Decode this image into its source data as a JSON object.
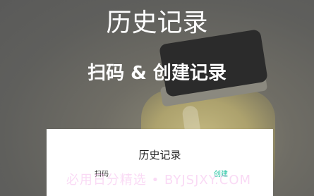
{
  "hero": {
    "title": "历史记录",
    "subtitle": "扫码 & 创建记录"
  },
  "panel": {
    "title": "历史记录",
    "scan_label": "扫码",
    "create_label": "创建"
  },
  "watermark": {
    "text": "必用日分精选 • BYJSJXY.COM"
  },
  "colors": {
    "accent": "#1fc3a0",
    "panel_background": "#ffffff",
    "overlay": "#5f5f5c"
  }
}
